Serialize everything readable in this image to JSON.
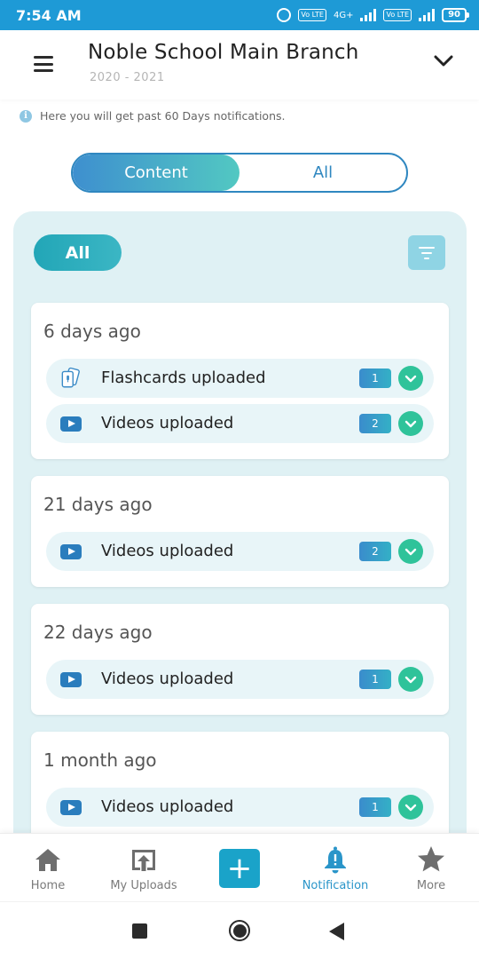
{
  "status_bar": {
    "time": "7:54 AM",
    "network": "4G+",
    "volte1": "Vo LTE",
    "volte2": "Vo LTE",
    "battery": "90"
  },
  "header": {
    "title": "Noble School Main Branch",
    "subtitle": "2020 - 2021"
  },
  "info": {
    "text": "Here you will get past 60 Days notifications."
  },
  "segment": {
    "content_label": "Content",
    "all_label": "All"
  },
  "filter": {
    "all_label": "All"
  },
  "cards": [
    {
      "title": "6 days ago",
      "rows": [
        {
          "icon": "flashcards-icon",
          "label": "Flashcards uploaded",
          "count": "1"
        },
        {
          "icon": "video-icon",
          "label": "Videos uploaded",
          "count": "2"
        }
      ]
    },
    {
      "title": "21 days ago",
      "rows": [
        {
          "icon": "video-icon",
          "label": "Videos uploaded",
          "count": "2"
        }
      ]
    },
    {
      "title": "22 days ago",
      "rows": [
        {
          "icon": "video-icon",
          "label": "Videos uploaded",
          "count": "1"
        }
      ]
    },
    {
      "title": "1 month ago",
      "rows": [
        {
          "icon": "video-icon",
          "label": "Videos uploaded",
          "count": "1"
        }
      ]
    }
  ],
  "bottom_nav": {
    "home": "Home",
    "uploads": "My Uploads",
    "notification": "Notification",
    "more": "More"
  },
  "colors": {
    "accent": "#1e9ad6",
    "teal": "#22a6b7",
    "green": "#2fc39a",
    "panel_bg": "#dff1f4"
  }
}
